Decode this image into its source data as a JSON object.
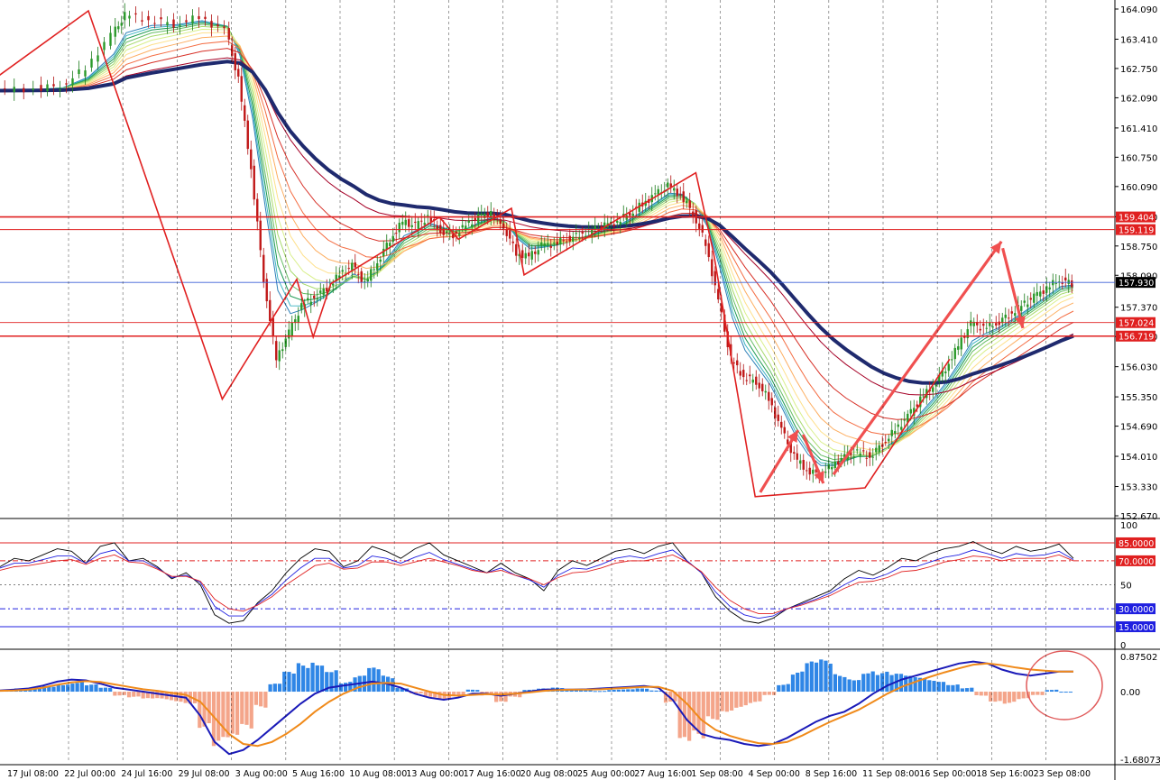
{
  "chart_data": [
    {
      "type": "candlestick",
      "panel": "main",
      "ylim": [
        152.67,
        164.09
      ],
      "y_ticks": [
        "164.090",
        "163.410",
        "162.750",
        "162.090",
        "161.410",
        "160.750",
        "160.090",
        "159.410",
        "158.750",
        "158.090",
        "157.370",
        "156.710",
        "156.030",
        "155.350",
        "154.690",
        "154.010",
        "153.330",
        "152.670"
      ],
      "x_ticks": [
        "17 Jul 08:00",
        "22 Jul 00:00",
        "24 Jul 16:00",
        "29 Jul 08:00",
        "3 Aug 00:00",
        "5 Aug 16:00",
        "10 Aug 08:00",
        "13 Aug 00:00",
        "17 Aug 16:00",
        "20 Aug 08:00",
        "25 Aug 00:00",
        "27 Aug 16:00",
        "1 Sep 08:00",
        "4 Sep 00:00",
        "8 Sep 16:00",
        "11 Sep 08:00",
        "16 Sep 00:00",
        "18 Sep 16:00",
        "23 Sep 08:00"
      ],
      "horizontal_levels": [
        {
          "value": 159.404,
          "label": "159.404",
          "color": "#e02020"
        },
        {
          "value": 159.119,
          "label": "159.119",
          "color": "#e02020"
        },
        {
          "value": 157.93,
          "label": "157.930",
          "color": "#3a5fd6"
        },
        {
          "value": 157.024,
          "label": "157.024",
          "color": "#e02020"
        },
        {
          "value": 156.719,
          "label": "156.719",
          "color": "#e02020"
        }
      ],
      "current_price": "157.930",
      "price_path": [
        [
          0,
          162.25
        ],
        [
          3,
          162.3
        ],
        [
          5,
          162.35
        ],
        [
          7,
          162.75
        ],
        [
          9,
          163.5
        ],
        [
          10,
          163.95
        ],
        [
          12,
          163.85
        ],
        [
          14,
          163.75
        ],
        [
          16,
          163.9
        ],
        [
          18,
          163.6
        ],
        [
          19,
          162.5
        ],
        [
          20,
          160.5
        ],
        [
          21,
          158.0
        ],
        [
          22,
          156.2
        ],
        [
          23,
          156.8
        ],
        [
          24,
          157.4
        ],
        [
          25,
          157.6
        ],
        [
          26,
          157.8
        ],
        [
          27,
          158.1
        ],
        [
          28,
          158.3
        ],
        [
          29,
          157.9
        ],
        [
          30,
          158.4
        ],
        [
          31,
          158.9
        ],
        [
          32,
          159.3
        ],
        [
          33,
          159.2
        ],
        [
          34,
          159.4
        ],
        [
          35,
          159.1
        ],
        [
          36,
          159.0
        ],
        [
          37,
          159.2
        ],
        [
          38,
          159.4
        ],
        [
          39,
          159.5
        ],
        [
          40,
          159.2
        ],
        [
          41,
          158.6
        ],
        [
          42,
          158.5
        ],
        [
          43,
          158.75
        ],
        [
          44,
          158.8
        ],
        [
          45,
          158.9
        ],
        [
          46,
          159.0
        ],
        [
          47,
          159.1
        ],
        [
          48,
          159.2
        ],
        [
          49,
          159.3
        ],
        [
          50,
          159.5
        ],
        [
          51,
          159.7
        ],
        [
          52,
          159.9
        ],
        [
          53,
          160.1
        ],
        [
          54,
          159.9
        ],
        [
          55,
          159.5
        ],
        [
          56,
          158.8
        ],
        [
          57,
          157.5
        ],
        [
          58,
          156.2
        ],
        [
          59,
          155.8
        ],
        [
          60,
          155.7
        ],
        [
          61,
          155.3
        ],
        [
          62,
          154.6
        ],
        [
          63,
          154.0
        ],
        [
          64,
          153.7
        ],
        [
          65,
          153.6
        ],
        [
          66,
          153.8
        ],
        [
          67,
          154.0
        ],
        [
          68,
          154.1
        ],
        [
          69,
          154.0
        ],
        [
          70,
          154.3
        ],
        [
          71,
          154.6
        ],
        [
          72,
          154.9
        ],
        [
          73,
          155.3
        ],
        [
          74,
          155.6
        ],
        [
          75,
          156.0
        ],
        [
          76,
          156.5
        ],
        [
          77,
          157.0
        ],
        [
          78,
          156.9
        ],
        [
          79,
          157.0
        ],
        [
          80,
          157.2
        ],
        [
          81,
          157.4
        ],
        [
          82,
          157.6
        ],
        [
          83,
          157.8
        ],
        [
          84,
          158.0
        ],
        [
          85,
          157.9
        ]
      ],
      "zigzag": [
        [
          -1,
          162.4
        ],
        [
          7,
          164.05
        ],
        [
          17.6,
          155.3
        ],
        [
          23.5,
          158.0
        ],
        [
          24.8,
          156.7
        ],
        [
          26.2,
          157.9
        ],
        [
          34.8,
          159.4
        ],
        [
          36.3,
          158.9
        ],
        [
          40.5,
          159.6
        ],
        [
          41.5,
          158.1
        ],
        [
          55.1,
          160.4
        ],
        [
          56.5,
          158.6
        ],
        [
          59.8,
          153.1
        ],
        [
          68.5,
          153.3
        ],
        [
          75.2,
          156.2
        ]
      ],
      "arrows": [
        {
          "from": [
            60.2,
            153.2
          ],
          "to": [
            63.2,
            154.6
          ]
        },
        {
          "from": [
            63.6,
            154.5
          ],
          "to": [
            65.2,
            153.4
          ]
        },
        {
          "from": [
            66.0,
            153.6
          ],
          "to": [
            79.3,
            158.85
          ]
        },
        {
          "from": [
            79.4,
            158.7
          ],
          "to": [
            81.0,
            156.9
          ]
        }
      ],
      "ma_color_bands": [
        "#2c7fb8",
        "#41b6c4",
        "#1a9850",
        "#66bd63",
        "#a6d96a",
        "#d9ef8b",
        "#fee08b",
        "#fdae61",
        "#f46d43",
        "#d73027",
        "#a50026"
      ],
      "slow_ma_color": "#1f2a6e"
    },
    {
      "type": "line",
      "panel": "oscillator",
      "ylim": [
        0,
        100
      ],
      "y_ticks": [
        "100",
        "50",
        "0"
      ],
      "levels": [
        {
          "value": 85,
          "label": "85.0000",
          "color": "#e02020"
        },
        {
          "value": 70,
          "label": "70.0000",
          "color": "#e02020"
        },
        {
          "value": 30,
          "label": "30.0000",
          "color": "#2020e0"
        },
        {
          "value": 15,
          "label": "15.0000",
          "color": "#2020e0"
        }
      ],
      "series": [
        {
          "color": "#000000",
          "values": [
            65,
            72,
            70,
            75,
            80,
            78,
            68,
            82,
            85,
            70,
            72,
            65,
            55,
            60,
            50,
            25,
            18,
            20,
            35,
            45,
            60,
            72,
            80,
            78,
            65,
            70,
            82,
            78,
            72,
            80,
            85,
            75,
            70,
            65,
            60,
            68,
            60,
            55,
            45,
            62,
            70,
            66,
            72,
            78,
            80,
            76,
            82,
            85,
            70,
            60,
            40,
            28,
            20,
            18,
            22,
            30,
            35,
            40,
            45,
            55,
            62,
            58,
            64,
            72,
            70,
            76,
            80,
            82,
            86,
            80,
            76,
            82,
            78,
            80,
            84,
            72
          ]
        },
        {
          "color": "#2020e0",
          "values": [
            64,
            68,
            68,
            71,
            74,
            74,
            68,
            76,
            79,
            70,
            70,
            64,
            56,
            58,
            52,
            32,
            24,
            24,
            34,
            42,
            54,
            64,
            72,
            72,
            64,
            66,
            74,
            72,
            68,
            73,
            77,
            71,
            67,
            63,
            60,
            64,
            58,
            54,
            48,
            58,
            64,
            63,
            67,
            72,
            74,
            72,
            76,
            79,
            70,
            60,
            44,
            32,
            25,
            22,
            24,
            30,
            34,
            38,
            43,
            50,
            56,
            55,
            59,
            65,
            65,
            69,
            73,
            75,
            79,
            76,
            72,
            76,
            74,
            75,
            78,
            71
          ]
        },
        {
          "color": "#e02020",
          "values": [
            62,
            65,
            66,
            68,
            70,
            71,
            67,
            72,
            75,
            69,
            68,
            63,
            57,
            57,
            53,
            38,
            30,
            28,
            33,
            40,
            50,
            58,
            66,
            68,
            63,
            64,
            69,
            69,
            66,
            69,
            72,
            69,
            66,
            62,
            60,
            62,
            58,
            55,
            50,
            56,
            60,
            61,
            64,
            68,
            70,
            70,
            72,
            75,
            69,
            61,
            48,
            37,
            30,
            26,
            26,
            30,
            33,
            37,
            41,
            47,
            52,
            53,
            56,
            61,
            62,
            65,
            69,
            71,
            74,
            73,
            70,
            72,
            72,
            72,
            75,
            70
          ]
        }
      ]
    },
    {
      "type": "bar",
      "panel": "macd",
      "ylim": [
        -1.68073,
        0.87502
      ],
      "y_ticks": [
        "0.87502",
        "0.00",
        "-1.68073"
      ],
      "histogram": [
        0.05,
        0.08,
        0.1,
        0.15,
        0.2,
        0.25,
        0.18,
        0.1,
        -0.1,
        -0.15,
        -0.2,
        -0.2,
        -0.25,
        -0.3,
        -0.9,
        -1.4,
        -1.3,
        -1.0,
        -0.4,
        0.2,
        0.5,
        0.72,
        0.8,
        0.6,
        0.25,
        0.4,
        0.6,
        0.4,
        0.1,
        -0.05,
        -0.15,
        -0.2,
        -0.1,
        0.05,
        -0.1,
        -0.3,
        -0.15,
        0.05,
        0.08,
        0.1,
        0.06,
        0.04,
        0.02,
        0.05,
        0.06,
        0.08,
        0.03,
        -0.3,
        -1.4,
        -1.2,
        -0.7,
        -0.5,
        -0.4,
        -0.3,
        -0.1,
        0.2,
        0.5,
        0.75,
        0.8,
        0.45,
        0.35,
        0.55,
        0.5,
        0.45,
        0.4,
        0.35,
        0.3,
        0.2,
        0.1,
        -0.1,
        -0.25,
        -0.3,
        -0.2,
        -0.1,
        0.05,
        0.0
      ],
      "main_line": [
        0.03,
        0.05,
        0.08,
        0.15,
        0.25,
        0.3,
        0.28,
        0.2,
        0.1,
        0.05,
        0.0,
        -0.05,
        -0.1,
        -0.15,
        -0.6,
        -1.25,
        -1.55,
        -1.45,
        -1.2,
        -0.9,
        -0.6,
        -0.3,
        -0.05,
        0.1,
        0.15,
        0.2,
        0.25,
        0.2,
        0.1,
        -0.05,
        -0.15,
        -0.2,
        -0.15,
        -0.05,
        -0.05,
        -0.1,
        -0.05,
        0.0,
        0.05,
        0.05,
        0.05,
        0.06,
        0.08,
        0.1,
        0.12,
        0.14,
        0.1,
        -0.2,
        -0.7,
        -1.05,
        -1.15,
        -1.2,
        -1.3,
        -1.35,
        -1.3,
        -1.15,
        -0.95,
        -0.75,
        -0.6,
        -0.5,
        -0.3,
        -0.05,
        0.15,
        0.3,
        0.4,
        0.5,
        0.6,
        0.7,
        0.75,
        0.7,
        0.55,
        0.45,
        0.4,
        0.45,
        0.5,
        0.5
      ],
      "signal_line": [
        0.02,
        0.03,
        0.05,
        0.1,
        0.17,
        0.23,
        0.26,
        0.24,
        0.18,
        0.12,
        0.06,
        0.02,
        -0.03,
        -0.08,
        -0.25,
        -0.65,
        -1.05,
        -1.3,
        -1.35,
        -1.25,
        -1.05,
        -0.8,
        -0.5,
        -0.25,
        -0.05,
        0.1,
        0.2,
        0.22,
        0.2,
        0.1,
        0.0,
        -0.08,
        -0.1,
        -0.08,
        -0.06,
        -0.07,
        -0.05,
        -0.02,
        0.02,
        0.04,
        0.05,
        0.05,
        0.06,
        0.08,
        0.1,
        0.12,
        0.12,
        0.02,
        -0.3,
        -0.7,
        -0.95,
        -1.1,
        -1.2,
        -1.28,
        -1.3,
        -1.25,
        -1.1,
        -0.92,
        -0.75,
        -0.6,
        -0.45,
        -0.25,
        -0.05,
        0.12,
        0.25,
        0.37,
        0.48,
        0.58,
        0.67,
        0.7,
        0.66,
        0.6,
        0.55,
        0.52,
        0.5,
        0.5
      ],
      "positive_color": "#2f86e6",
      "negative_color": "#f4a58a",
      "main_color": "#1a1ab8",
      "signal_color": "#f08a1a"
    }
  ]
}
